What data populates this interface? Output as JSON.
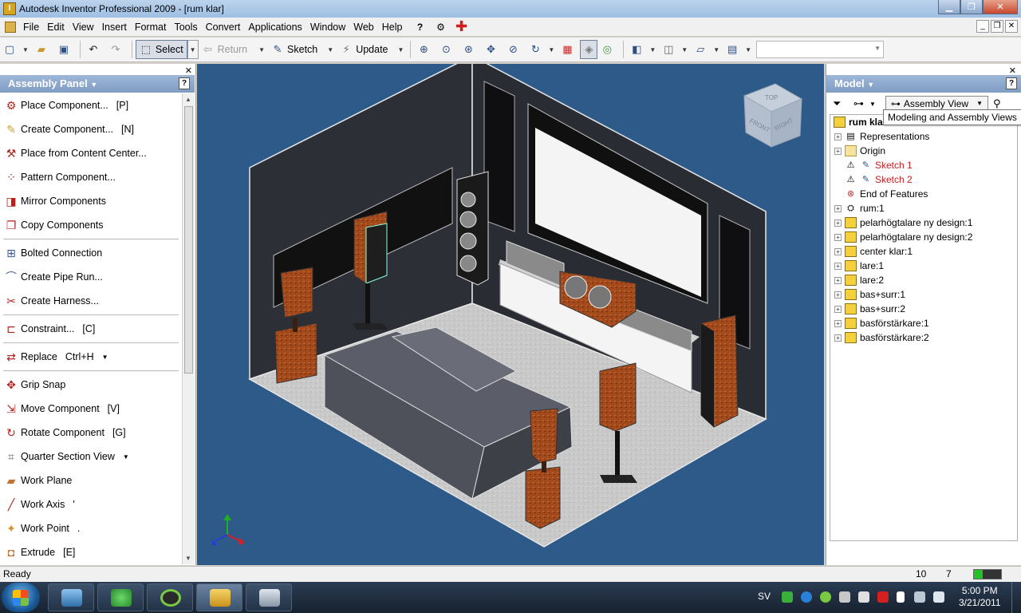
{
  "window": {
    "title": "Autodesk Inventor Professional 2009 - [rum klar]"
  },
  "menu": [
    "File",
    "Edit",
    "View",
    "Insert",
    "Format",
    "Tools",
    "Convert",
    "Applications",
    "Window",
    "Web",
    "Help"
  ],
  "toolbar": {
    "select_label": "Select",
    "return_label": "Return",
    "sketch_label": "Sketch",
    "update_label": "Update"
  },
  "assembly_panel": {
    "title": "Assembly Panel",
    "items": [
      {
        "label": "Place Component...",
        "shortcut": "[P]"
      },
      {
        "label": "Create Component...",
        "shortcut": "[N]"
      },
      {
        "label": "Place from Content Center...",
        "shortcut": ""
      },
      {
        "label": "Pattern Component...",
        "shortcut": ""
      },
      {
        "label": "Mirror Components",
        "shortcut": ""
      },
      {
        "label": "Copy Components",
        "shortcut": ""
      },
      {
        "label": "Bolted Connection",
        "shortcut": ""
      },
      {
        "label": "Create Pipe Run...",
        "shortcut": ""
      },
      {
        "label": "Create Harness...",
        "shortcut": ""
      },
      {
        "label": "Constraint...",
        "shortcut": "[C]"
      },
      {
        "label": "Replace",
        "shortcut": "Ctrl+H"
      },
      {
        "label": "Grip Snap",
        "shortcut": ""
      },
      {
        "label": "Move Component",
        "shortcut": "[V]"
      },
      {
        "label": "Rotate Component",
        "shortcut": "[G]"
      },
      {
        "label": "Quarter Section View",
        "shortcut": ""
      },
      {
        "label": "Work Plane",
        "shortcut": ""
      },
      {
        "label": "Work Axis",
        "shortcut": "'"
      },
      {
        "label": "Work Point",
        "shortcut": "."
      },
      {
        "label": "Extrude",
        "shortcut": "[E]"
      }
    ]
  },
  "viewcube": {
    "top": "TOP",
    "front": "FRONT",
    "right": "RIGHT"
  },
  "model_panel": {
    "title": "Model",
    "view_select": "Assembly View",
    "tooltip": "Modeling and Assembly Views",
    "tree": [
      {
        "label": "rum klar",
        "kind": "root"
      },
      {
        "label": "Representations",
        "kind": "folder"
      },
      {
        "label": "Origin",
        "kind": "folder"
      },
      {
        "label": "Sketch 1",
        "kind": "sketch"
      },
      {
        "label": "Sketch 2",
        "kind": "sketch"
      },
      {
        "label": "End of Features",
        "kind": "end"
      },
      {
        "label": "rum:1",
        "kind": "part"
      },
      {
        "label": "pelarhögtalare ny design:1",
        "kind": "part"
      },
      {
        "label": "pelarhögtalare ny design:2",
        "kind": "part"
      },
      {
        "label": "center klar:1",
        "kind": "part"
      },
      {
        "label": "lare:1",
        "kind": "part"
      },
      {
        "label": "lare:2",
        "kind": "part"
      },
      {
        "label": "bas+surr:1",
        "kind": "part"
      },
      {
        "label": "bas+surr:2",
        "kind": "part"
      },
      {
        "label": "basförstärkare:1",
        "kind": "part"
      },
      {
        "label": "basförstärkare:2",
        "kind": "part"
      }
    ]
  },
  "status": {
    "text": "Ready",
    "num1": "10",
    "num2": "7"
  },
  "taskbar": {
    "language": "SV",
    "time": "5:00 PM",
    "date": "3/21/2011"
  }
}
